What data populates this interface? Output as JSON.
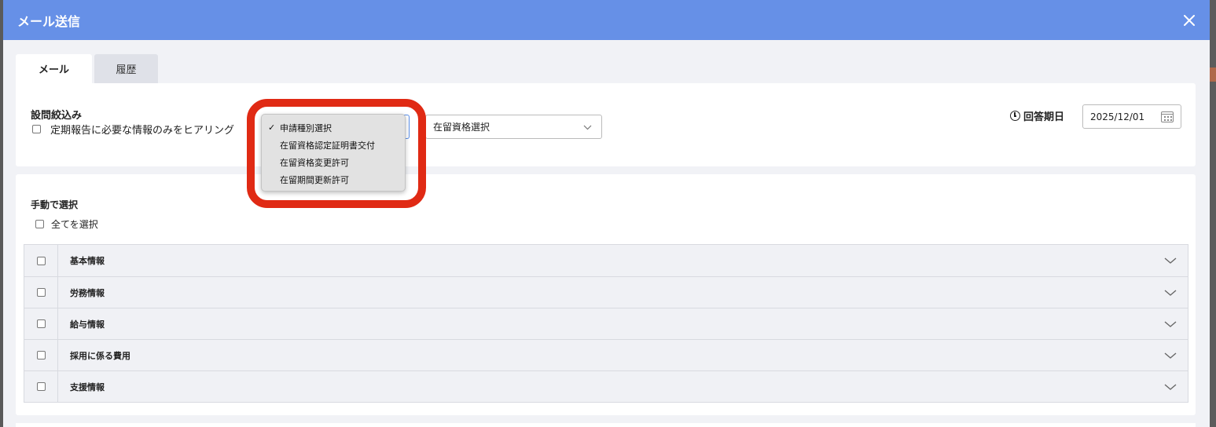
{
  "modal": {
    "title": "メール送信"
  },
  "tabs": [
    {
      "label": "メール"
    },
    {
      "label": "履歴"
    }
  ],
  "filter": {
    "title": "設問絞込み",
    "checkbox_label": "定期報告に必要な情報のみをヒアリング",
    "residence_select_value": "在留資格選択",
    "due_label": "回答期日",
    "due_date": "2025/12/01"
  },
  "application_dropdown": {
    "options": [
      {
        "label": "申請種別選択",
        "selected": true
      },
      {
        "label": "在留資格認定証明書交付",
        "selected": false
      },
      {
        "label": "在留資格変更許可",
        "selected": false
      },
      {
        "label": "在留期間更新許可",
        "selected": false
      }
    ],
    "checkmark": "✓"
  },
  "manual": {
    "title": "手動で選択",
    "select_all_label": "全てを選択",
    "sections": [
      "基本情報",
      "労務情報",
      "給与情報",
      "採用に係る費用",
      "支援情報"
    ]
  },
  "icons": {
    "close": "close-icon",
    "clock": "clock-icon",
    "calendar": "calendar-icon",
    "chevron": "chevron-down-icon"
  },
  "colors": {
    "header": "#6690e7",
    "highlight_ring": "#e02a14"
  }
}
